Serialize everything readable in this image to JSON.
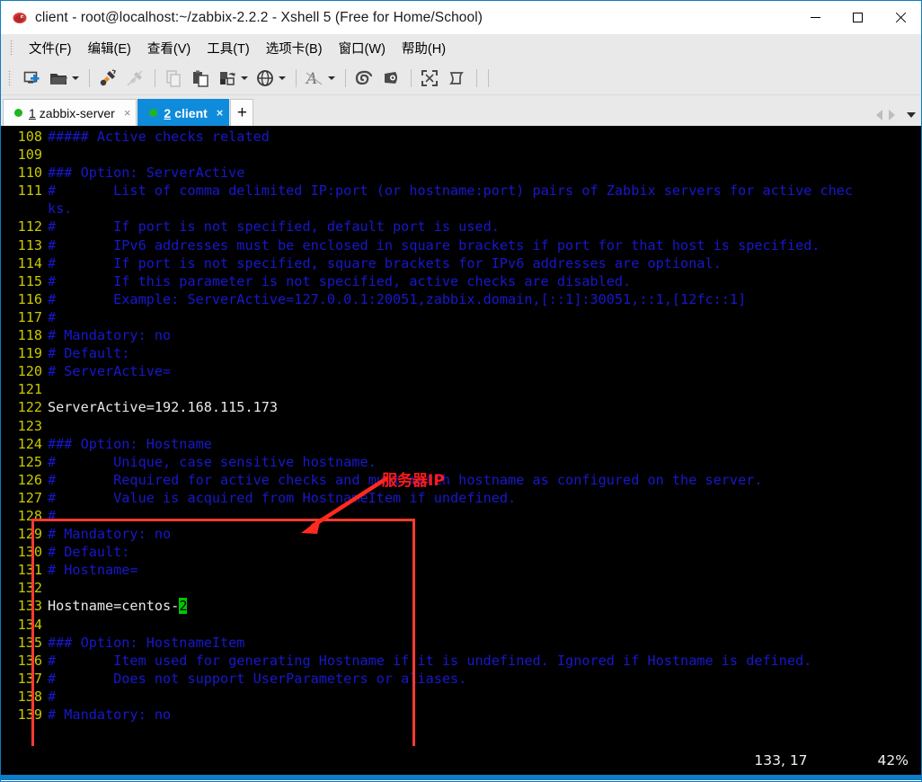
{
  "window": {
    "title": "client - root@localhost:~/zabbix-2.2.2 - Xshell 5 (Free for Home/School)",
    "app_icon": "xshell-icon",
    "minimize_label": "—",
    "maximize_label": "□",
    "close_label": "✕"
  },
  "menubar": {
    "items": [
      {
        "label": "文件(F)",
        "name": "menu-file"
      },
      {
        "label": "编辑(E)",
        "name": "menu-edit"
      },
      {
        "label": "查看(V)",
        "name": "menu-view"
      },
      {
        "label": "工具(T)",
        "name": "menu-tools"
      },
      {
        "label": "选项卡(B)",
        "name": "menu-tabs"
      },
      {
        "label": "窗口(W)",
        "name": "menu-window"
      },
      {
        "label": "帮助(H)",
        "name": "menu-help"
      }
    ]
  },
  "toolbar": {
    "icons": [
      "new-session-icon",
      "open-session-icon",
      "connect-icon",
      "disconnect-icon",
      "copy-icon",
      "paste-icon",
      "file-transfer-icon",
      "globe-icon",
      "font-icon",
      "shell-icon",
      "shell-alt-icon",
      "fullscreen-icon",
      "log-icon"
    ]
  },
  "tabs": {
    "items": [
      {
        "number": "1",
        "label": "zabbix-server",
        "active": false,
        "status": "connected",
        "close": "×"
      },
      {
        "number": "2",
        "label": "client",
        "active": true,
        "status": "connected",
        "close": "×"
      }
    ],
    "add_label": "+",
    "nav_prev": "scroll-tabs-left-icon",
    "nav_next": "scroll-tabs-right-icon",
    "nav_menu": "tab-list-dropdown-icon"
  },
  "terminal": {
    "lines": [
      {
        "n": "108",
        "text": "##### Active checks related",
        "type": "comment"
      },
      {
        "n": "109",
        "text": "",
        "type": "comment"
      },
      {
        "n": "110",
        "text": "### Option: ServerActive",
        "type": "comment"
      },
      {
        "n": "111",
        "text": "#       List of comma delimited IP:port (or hostname:port) pairs of Zabbix servers for active chec",
        "type": "comment",
        "wrap": "ks."
      },
      {
        "n": "112",
        "text": "#       If port is not specified, default port is used.",
        "type": "comment"
      },
      {
        "n": "113",
        "text": "#       IPv6 addresses must be enclosed in square brackets if port for that host is specified.",
        "type": "comment"
      },
      {
        "n": "114",
        "text": "#       If port is not specified, square brackets for IPv6 addresses are optional.",
        "type": "comment"
      },
      {
        "n": "115",
        "text": "#       If this parameter is not specified, active checks are disabled.",
        "type": "comment"
      },
      {
        "n": "116",
        "text": "#       Example: ServerActive=127.0.0.1:20051,zabbix.domain,[::1]:30051,::1,[12fc::1]",
        "type": "comment"
      },
      {
        "n": "117",
        "text": "#",
        "type": "comment"
      },
      {
        "n": "118",
        "text": "# Mandatory: no",
        "type": "comment"
      },
      {
        "n": "119",
        "text": "# Default:",
        "type": "comment"
      },
      {
        "n": "120",
        "text": "# ServerActive=",
        "type": "comment"
      },
      {
        "n": "121",
        "text": "",
        "type": "comment"
      },
      {
        "n": "122",
        "text": "ServerActive=192.168.115.173",
        "type": "value"
      },
      {
        "n": "123",
        "text": "",
        "type": "comment"
      },
      {
        "n": "124",
        "text": "### Option: Hostname",
        "type": "comment"
      },
      {
        "n": "125",
        "text": "#       Unique, case sensitive hostname.",
        "type": "comment"
      },
      {
        "n": "126",
        "text": "#       Required for active checks and must match hostname as configured on the server.",
        "type": "comment"
      },
      {
        "n": "127",
        "text": "#       Value is acquired from HostnameItem if undefined.",
        "type": "comment"
      },
      {
        "n": "128",
        "text": "#",
        "type": "comment"
      },
      {
        "n": "129",
        "text": "# Mandatory: no",
        "type": "comment"
      },
      {
        "n": "130",
        "text": "# Default:",
        "type": "comment"
      },
      {
        "n": "131",
        "text": "# Hostname=",
        "type": "comment"
      },
      {
        "n": "132",
        "text": "",
        "type": "comment"
      },
      {
        "n": "133",
        "text": "Hostname=centos-",
        "type": "value",
        "cursor": "2"
      },
      {
        "n": "134",
        "text": "",
        "type": "comment"
      },
      {
        "n": "135",
        "text": "### Option: HostnameItem",
        "type": "comment"
      },
      {
        "n": "136",
        "text": "#       Item used for generating Hostname if it is undefined. Ignored if Hostname is defined.",
        "type": "comment"
      },
      {
        "n": "137",
        "text": "#       Does not support UserParameters or aliases.",
        "type": "comment"
      },
      {
        "n": "138",
        "text": "#",
        "type": "comment"
      },
      {
        "n": "139",
        "text": "# Mandatory: no",
        "type": "comment"
      }
    ],
    "status": {
      "position": "133, 17",
      "zoom": "42%"
    },
    "colors": {
      "background": "#000000",
      "line_number": "#c9c900",
      "comment": "#1818cc",
      "value": "#e8e8e8",
      "cursor_bg": "#00c800"
    }
  },
  "annotation": {
    "label": "服务器IP",
    "color": "#ff1a1a",
    "shape": "rectangle-highlight-with-arrow"
  }
}
